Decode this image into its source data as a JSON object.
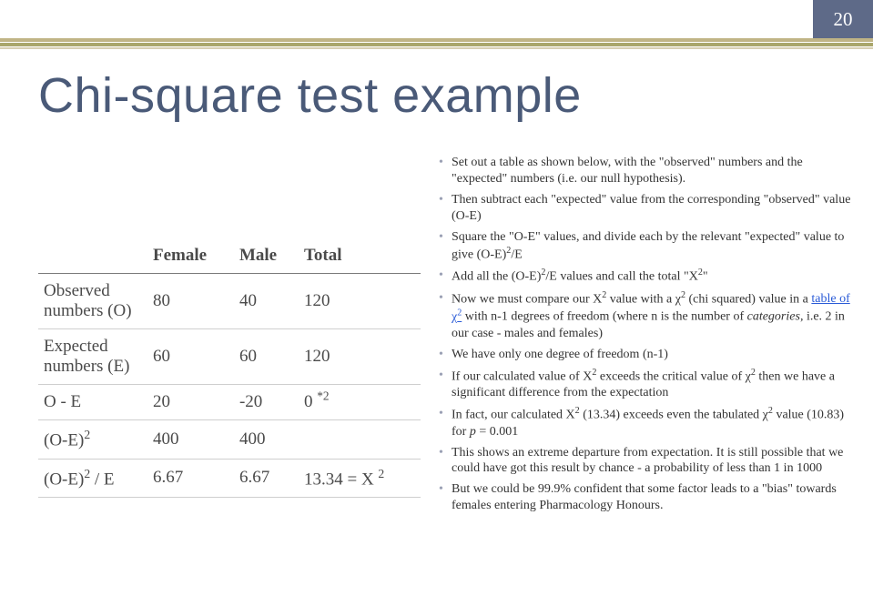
{
  "page_number": "20",
  "title": "Chi-square test example",
  "table": {
    "headers": [
      "",
      "Female",
      "Male",
      "Total"
    ],
    "rows": [
      {
        "label": "Observed numbers (O)",
        "cells": [
          "80",
          "40",
          "120"
        ]
      },
      {
        "label": "Expected numbers (E)",
        "cells": [
          "60",
          "60",
          "120"
        ]
      },
      {
        "label": "O - E",
        "cells": [
          "20",
          "-20",
          "0 "
        ],
        "note": "*2"
      },
      {
        "label_pre": "(O-E)",
        "label_sup": "2",
        "cells": [
          "400",
          "400",
          ""
        ]
      },
      {
        "label_pre": "(O-E)",
        "label_sup": "2",
        "label_post": " / E",
        "cells": [
          "6.67",
          "6.67",
          "13.34 = X"
        ],
        "cell2_sup": "2"
      }
    ]
  },
  "bullets": {
    "0": "Set out a table as shown below, with the \"observed\" numbers and the \"expected\" numbers (i.e. our null hypothesis).",
    "1": "Then subtract each \"expected\" value from the corresponding \"observed\" value (O-E)",
    "2": {
      "pre": "Square the \"O-E\" values, and divide each by the relevant \"expected\" value to give (O-E)",
      "sup": "2",
      "post": "/E"
    },
    "3": {
      "pre": "Add all the (O-E)",
      "sup1": "2",
      "mid": "/E values and call the total \"X",
      "sup2": "2",
      "post": "\""
    },
    "4": {
      "pre": "Now we must compare our X",
      "sup1": "2",
      "mid1": " value with a χ",
      "sup2": "2",
      "mid2": " (chi squared) value in a ",
      "link_pre": "table of χ",
      "link_sup": "2",
      "mid3": " with n-1 degrees of freedom (where n is the number of ",
      "ital": "categories",
      "post": ", i.e. 2 in our case - males and females)"
    },
    "5": "We have only one degree of freedom (n-1)",
    "6": {
      "pre": "If our calculated value of X",
      "sup1": "2",
      "mid": " exceeds the critical value of χ",
      "sup2": "2",
      "post": " then we have a significant difference from the expectation"
    },
    "7": {
      "pre": "In fact, our calculated X",
      "sup1": "2",
      "mid": " (13.34) exceeds even the tabulated χ",
      "sup2": "2",
      "mid2": " value (10.83) for ",
      "ital": "p",
      "post": " = 0.001"
    },
    "8": "This shows an extreme departure from expectation. It is still possible that we could have got this result by chance - a probability of less than 1 in 1000",
    "9": "But we could be 99.9% confident that some factor leads to a \"bias\" towards females entering Pharmacology Honours."
  },
  "chart_data": {
    "type": "table",
    "title": "Chi-square test example",
    "columns": [
      "",
      "Female",
      "Male",
      "Total"
    ],
    "rows": [
      [
        "Observed numbers (O)",
        80,
        40,
        120
      ],
      [
        "Expected numbers (E)",
        60,
        60,
        120
      ],
      [
        "O - E",
        20,
        -20,
        "0 *2"
      ],
      [
        "(O-E)^2",
        400,
        400,
        null
      ],
      [
        "(O-E)^2 / E",
        6.67,
        6.67,
        "13.34 = X^2"
      ]
    ],
    "statistic": {
      "X2": 13.34,
      "df": 1,
      "critical_value_p_0.001": 10.83
    }
  }
}
